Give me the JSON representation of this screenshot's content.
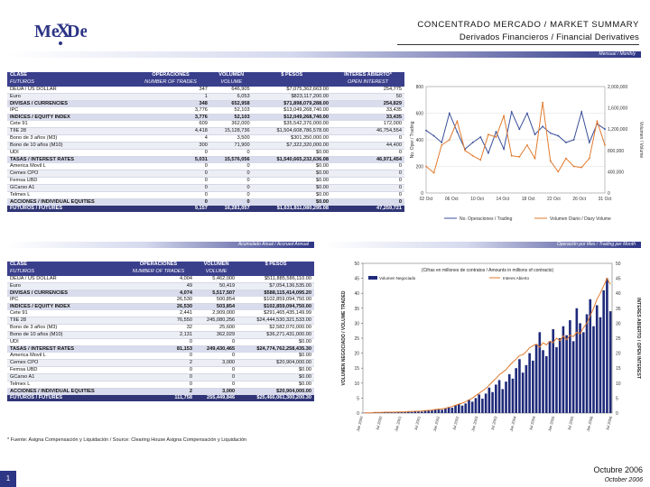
{
  "header": {
    "logo_text": "MexDer",
    "title": "CONCENTRADO MERCADO / MARKET SUMMARY",
    "subtitle": "Derivados Financieros / Financial Derivatives"
  },
  "monthly_banner": "Mensual / Monthly",
  "monthly_table": {
    "headers": [
      "CLASE",
      "OPERACIONES",
      "VOLUMEN",
      "$ PESOS",
      "INTERES ABIERTO*"
    ],
    "subheaders": [
      "FUTUROS",
      "NUMBER OF TRADES",
      "VOLUME",
      "",
      "OPEN INTEREST"
    ],
    "rows": [
      {
        "name": "DEUA / US DOLLAR",
        "ops": "347",
        "vol": "646,905",
        "pesos": "$7,075,362,663.00",
        "oi": "254,775",
        "style": "r"
      },
      {
        "name": "Euro",
        "ops": "1",
        "vol": "6,053",
        "pesos": "$823,117,200.00",
        "oi": "50",
        "style": "alt"
      },
      {
        "name": "DIVISAS / CURRENCIES",
        "ops": "348",
        "vol": "652,958",
        "pesos": "$71,898,079,288.00",
        "oi": "254,829",
        "style": "sum"
      },
      {
        "name": "IPC",
        "ops": "3,776",
        "vol": "52,103",
        "pesos": "$13,049,268,740.00",
        "oi": "33,435",
        "style": "r"
      },
      {
        "name": "INDICES / EQUITY INDEX",
        "ops": "3,776",
        "vol": "52,103",
        "pesos": "$12,049,268,740.00",
        "oi": "33,435",
        "style": "sum"
      },
      {
        "name": "Cete 91",
        "ops": "609",
        "vol": "362,000",
        "pesos": "$35,542,376,000.00",
        "oi": "172,000",
        "style": "r"
      },
      {
        "name": "TIIE 28",
        "ops": "4,418",
        "vol": "15,128,736",
        "pesos": "$1,504,608,786,578.00",
        "oi": "46,754,554",
        "style": "alt"
      },
      {
        "name": "Bono de 3 años (M3)",
        "ops": "4",
        "vol": "3,500",
        "pesos": "$301,350,000.00",
        "oi": "0",
        "style": "r"
      },
      {
        "name": "Bono de 10 años (M10)",
        "ops": "300",
        "vol": "71,900",
        "pesos": "$7,322,320,000.00",
        "oi": "44,400",
        "style": "alt"
      },
      {
        "name": "UDI",
        "ops": "0",
        "vol": "0",
        "pesos": "$0.00",
        "oi": "0",
        "style": "r"
      },
      {
        "name": "TASAS / INTEREST RATES",
        "ops": "5,031",
        "vol": "15,576,056",
        "pesos": "$1,540,665,232,636.08",
        "oi": "46,971,454",
        "style": "sum"
      },
      {
        "name": "America Movil L",
        "ops": "0",
        "vol": "0",
        "pesos": "$0.00",
        "oi": "0",
        "style": "r"
      },
      {
        "name": "Cemex CPO",
        "ops": "0",
        "vol": "0",
        "pesos": "$0.00",
        "oi": "0",
        "style": "alt"
      },
      {
        "name": "Femsa UBD",
        "ops": "0",
        "vol": "0",
        "pesos": "$0.00",
        "oi": "0",
        "style": "r"
      },
      {
        "name": "GCarso A1",
        "ops": "0",
        "vol": "0",
        "pesos": "$0.00",
        "oi": "0",
        "style": "alt"
      },
      {
        "name": "Telmex L",
        "ops": "0",
        "vol": "0",
        "pesos": "$0.00",
        "oi": "0",
        "style": "r"
      },
      {
        "name": "ACCIONES / INDIVIDUAL EQUITIES",
        "ops": "0",
        "vol": "0",
        "pesos": "$0.00",
        "oi": "0",
        "style": "sum"
      },
      {
        "name": "FUTUROS / FUTURES",
        "ops": "9,157",
        "vol": "16,281,057",
        "pesos": "$1,631,811,080,295.08",
        "oi": "47,259,721",
        "style": "tot"
      }
    ]
  },
  "annual_banner": "Acumulado Anual / Accrued Annual",
  "annual_table": {
    "headers": [
      "CLASE",
      "OPERACIONES",
      "VOLUMEN",
      "$ PESOS"
    ],
    "subheaders": [
      "FUTUROS",
      "NUMBER OF TRADES",
      "VOLUME",
      ""
    ],
    "rows": [
      {
        "name": "DEUA / US DOLLAR",
        "ops": "4,004",
        "vol": "5,462,000",
        "pesos": "$511,885,586,110.00",
        "style": "r"
      },
      {
        "name": "Euro",
        "ops": "49",
        "vol": "50,419",
        "pesos": "$7,054,136,535.00",
        "style": "alt"
      },
      {
        "name": "DIVISAS / CURRENCIES",
        "ops": "4,074",
        "vol": "5,517,507",
        "pesos": "$588,115,414,095.20",
        "style": "sum"
      },
      {
        "name": "IPC",
        "ops": "26,530",
        "vol": "500,854",
        "pesos": "$102,859,094,750.00",
        "style": "r"
      },
      {
        "name": "INDICES / EQUITY INDEX",
        "ops": "26,530",
        "vol": "503,854",
        "pesos": "$102,859,094,750.00",
        "style": "sum"
      },
      {
        "name": "Cete 91",
        "ops": "2,441",
        "vol": "2,909,000",
        "pesos": "$291,465,435,149.99",
        "style": "r"
      },
      {
        "name": "TIIE 28",
        "ops": "76,550",
        "vol": "245,080,256",
        "pesos": "$24,444,530,321,533.00",
        "style": "alt"
      },
      {
        "name": "Bono de 3 años (M3)",
        "ops": "32",
        "vol": "25,600",
        "pesos": "$2,582,070,000.00",
        "style": "r"
      },
      {
        "name": "Bono de 10 años (M10)",
        "ops": "2,131",
        "vol": "362,029",
        "pesos": "$36,271,431,000.00",
        "style": "alt"
      },
      {
        "name": "UDI",
        "ops": "0",
        "vol": "0",
        "pesos": "$0.00",
        "style": "r"
      },
      {
        "name": "TASAS / INTEREST RATES",
        "ops": "81,153",
        "vol": "249,430,465",
        "pesos": "$24,774,762,258,435.30",
        "style": "sum"
      },
      {
        "name": "America Movil L",
        "ops": "0",
        "vol": "0",
        "pesos": "$0.00",
        "style": "r"
      },
      {
        "name": "Cemex CPO",
        "ops": "2",
        "vol": "3,000",
        "pesos": "$20,904,000.00",
        "style": "alt"
      },
      {
        "name": "Femsa UBD",
        "ops": "0",
        "vol": "0",
        "pesos": "$0.00",
        "style": "r"
      },
      {
        "name": "GCarso A1",
        "ops": "0",
        "vol": "0",
        "pesos": "$0.00",
        "style": "alt"
      },
      {
        "name": "Telmex L",
        "ops": "0",
        "vol": "0",
        "pesos": "$0.00",
        "style": "r"
      },
      {
        "name": "ACCIONES / INDIVIDUAL EQUITIES",
        "ops": "2",
        "vol": "3,000",
        "pesos": "$20,904,000.00",
        "style": "sum"
      },
      {
        "name": "FUTUROS / FUTURES",
        "ops": "111,758",
        "vol": "255,449,846",
        "pesos": "$25,466,061,300,200.30",
        "style": "tot"
      }
    ]
  },
  "trading_banner": "Operación por Mes / Trading per Month",
  "footnote": "* Fuente: Asigna Compensación y Liquidación / Source: Clearing House Asigna Compensación y Liquidación",
  "footer": {
    "page": "1",
    "date_es": "Octubre 2006",
    "date_en": "October 2006"
  },
  "colors": {
    "navy": "#2d3585",
    "blue_line": "#3a4f9a",
    "orange_line": "#e07a2e",
    "bars": "#1f2a7a"
  },
  "chart_data": [
    {
      "type": "line",
      "x": [
        "02 Oct",
        "06 Oct",
        "10 Oct",
        "14 Oct",
        "18 Oct",
        "22 Oct",
        "26 Oct",
        "31 Oct"
      ],
      "ylabel": "No. Oper./ Trading",
      "y2label": "Volumen / Volume",
      "ylim": [
        0,
        800
      ],
      "y_ticks": [
        "0",
        "200",
        "400",
        "600",
        "800"
      ],
      "y2lim": [
        0,
        2000000
      ],
      "y2_ticks": [
        "0",
        "400,000",
        "800,000",
        "1,200,000",
        "1,600,000",
        "2,000,000"
      ],
      "legend_position": "bottom",
      "series": [
        {
          "name": "No. Operaciones / Trading",
          "axis": "left",
          "values": [
            470,
            430,
            380,
            600,
            460,
            330,
            380,
            420,
            300,
            460,
            330,
            610,
            480,
            600,
            440,
            500,
            450,
            430,
            380,
            400,
            610,
            380,
            520,
            480
          ]
        },
        {
          "name": "Volumen Diario / Diary Volume",
          "axis": "right",
          "values": [
            500000,
            380000,
            900000,
            1000000,
            1350000,
            800000,
            700000,
            620000,
            1100000,
            1050000,
            1450000,
            700000,
            680000,
            900000,
            650000,
            1700000,
            600000,
            400000,
            650000,
            500000,
            480000,
            650000,
            1350000,
            900000
          ]
        }
      ]
    },
    {
      "type": "bar",
      "title": "(Cifras en millones de contratos / Amounts in millions of contracts)",
      "ylabel": "VOLUMEN NEGOCIADO / VOLUME TRADED",
      "y2label": "INTERES ABIERTO / OPEN INTEREST",
      "ylim": [
        0,
        50
      ],
      "y_ticks": [
        "0",
        "5",
        "10",
        "15",
        "20",
        "25",
        "30",
        "35",
        "40",
        "45",
        "50"
      ],
      "y2lim": [
        0,
        50
      ],
      "y2_ticks": [
        "0",
        "5",
        "10",
        "15",
        "20",
        "25",
        "30",
        "35",
        "40",
        "45",
        "50"
      ],
      "legend_position": "top",
      "x_labels": [
        "Jan 2000",
        "Jul 2000",
        "Jan 2001",
        "Jul 2001",
        "Jan 2002",
        "Jul 2002",
        "Jan 2003",
        "Jul 2003",
        "Jan 2004",
        "Jul 2004",
        "Jan 2005",
        "Jul 2005",
        "Jan 2006",
        "Jul 2006"
      ],
      "series": [
        {
          "name": "Volumen Negociado",
          "type": "bar",
          "values": [
            0.1,
            0.1,
            0.1,
            0.2,
            0.1,
            0.2,
            0.3,
            0.2,
            0.3,
            0.2,
            0.3,
            0.4,
            0.3,
            0.4,
            0.4,
            0.5,
            0.6,
            0.5,
            0.8,
            1.0,
            0.9,
            1.2,
            1.4,
            1.1,
            1.5,
            2.0,
            1.8,
            2.6,
            3.0,
            2.5,
            3.2,
            4.5,
            3.8,
            5.0,
            6.2,
            4.8,
            6.5,
            8.5,
            7.0,
            9.5,
            11.0,
            8.0,
            10.5,
            13.0,
            11.5,
            15.0,
            18.0,
            13.5,
            16.0,
            20.0,
            17.5,
            23.0,
            27.0,
            21.0,
            19.0,
            24.0,
            28.0,
            22.0,
            25.0,
            29.0,
            26.0,
            31.0,
            24.0,
            35.0,
            30.0,
            27.0,
            33.0,
            38.0,
            29.0,
            36.0,
            32.0,
            41.0,
            45.0,
            34.0
          ]
        },
        {
          "name": "Interes Abierto",
          "type": "line",
          "values": [
            0.1,
            0.1,
            0.1,
            0.2,
            0.2,
            0.2,
            0.3,
            0.3,
            0.3,
            0.3,
            0.4,
            0.4,
            0.4,
            0.5,
            0.5,
            0.6,
            0.6,
            0.7,
            0.8,
            0.9,
            1.0,
            1.2,
            1.3,
            1.4,
            1.6,
            1.9,
            2.2,
            2.6,
            3.0,
            3.3,
            3.8,
            4.4,
            5.0,
            5.8,
            6.6,
            7.4,
            8.2,
            9.3,
            10.5,
            11.5,
            12.8,
            13.6,
            14.5,
            15.8,
            17.0,
            18.0,
            19.2,
            19.5,
            20.5,
            21.8,
            22.5,
            23.0,
            22.0,
            23.5,
            22.8,
            24.0,
            23.5,
            25.0,
            24.2,
            25.8,
            24.5,
            26.0,
            25.5,
            27.0,
            26.5,
            28.5,
            30.0,
            32.5,
            35.0,
            38.0,
            40.0,
            42.5,
            45.0,
            43.0
          ]
        }
      ]
    }
  ]
}
